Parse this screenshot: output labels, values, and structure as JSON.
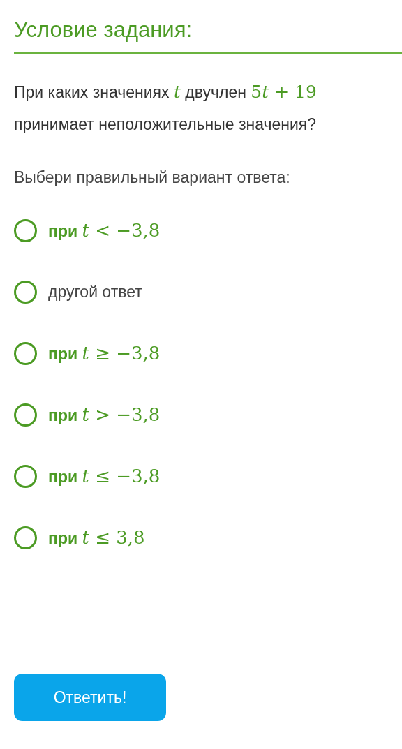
{
  "title": "Условие задания:",
  "question": [
    {
      "kind": "text",
      "text": "При каких значениях "
    },
    {
      "kind": "math",
      "text": "*t*"
    },
    {
      "kind": "text",
      "text": " двучлен "
    },
    {
      "kind": "math",
      "text": "5"
    },
    {
      "kind": "math",
      "text": "*t* + 19"
    },
    {
      "kind": "text",
      "text": " принимает неположительные значения?"
    }
  ],
  "prompt": "Выбери правильный вариант ответа:",
  "options": [
    {
      "kind": "math",
      "prefix": "при",
      "math": "*t* < −3,8",
      "selected": false
    },
    {
      "kind": "plain",
      "text": "другой ответ",
      "selected": false
    },
    {
      "kind": "math",
      "prefix": "при",
      "math": "*t* ≥ −3,8",
      "selected": false
    },
    {
      "kind": "math",
      "prefix": "при",
      "math": "*t* > −3,8",
      "selected": false
    },
    {
      "kind": "math",
      "prefix": "при",
      "math": "*t* ≤ −3,8",
      "selected": false
    },
    {
      "kind": "math",
      "prefix": "при",
      "math": "*t* ≤ 3,8",
      "selected": false
    }
  ],
  "button": "Ответить!"
}
